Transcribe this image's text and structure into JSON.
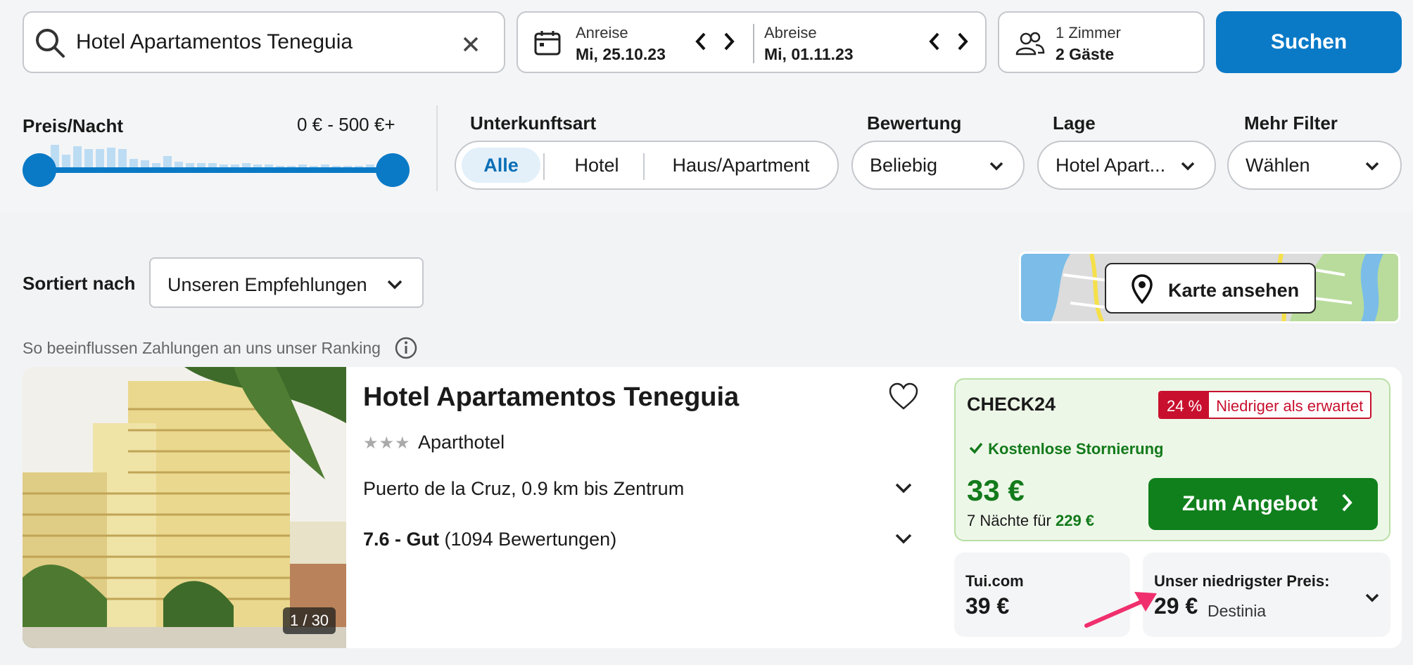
{
  "search": {
    "query": "Hotel Apartamentos Teneguia",
    "clear_icon": "close-icon",
    "submit_label": "Suchen"
  },
  "dates": {
    "checkin_label": "Anreise",
    "checkin_value": "Mi, 25.10.23",
    "checkout_label": "Abreise",
    "checkout_value": "Mi, 01.11.23"
  },
  "guests": {
    "rooms": "1 Zimmer",
    "guests": "2 Gäste"
  },
  "filters": {
    "price_label": "Preis/Nacht",
    "price_range": "0 € - 500 €+",
    "price_min_value": 0,
    "price_max_value": 500,
    "accommodation_label": "Unterkunftsart",
    "accommodation_options": [
      "Alle",
      "Hotel",
      "Haus/Apartment"
    ],
    "accommodation_selected": "Alle",
    "rating_label": "Bewertung",
    "rating_value": "Beliebig",
    "location_label": "Lage",
    "location_value": "Hotel Apart...",
    "more_label": "Mehr Filter",
    "more_value": "Wählen"
  },
  "sort": {
    "label": "Sortiert nach",
    "value": "Unseren Empfehlungen"
  },
  "map": {
    "button_label": "Karte ansehen"
  },
  "ranking_info": "So beeinflussen Zahlungen an uns unser Ranking",
  "hotel": {
    "name": "Hotel Apartamentos Teneguia",
    "stars": 3,
    "stars_glyph": "★★★",
    "type": "Aparthotel",
    "location": "Puerto de la Cruz, 0.9 km bis Zentrum",
    "rating_score": "7.6 - Gut",
    "rating_count": "(1094 Bewertungen)",
    "photo_counter": "1 / 30"
  },
  "offer": {
    "provider": "CHECK24",
    "discount_pct": "24 %",
    "discount_text": "Niedriger als erwartet",
    "free_cancel": "Kostenlose Stornierung",
    "price": "33 €",
    "nights_text": "7 Nächte für",
    "total": "229 €",
    "cta_label": "Zum Angebot"
  },
  "alternatives": [
    {
      "provider": "Tui.com",
      "price": "39 €"
    },
    {
      "label": "Unser niedrigster Preis:",
      "price": "29 €",
      "provider": "Destinia"
    }
  ],
  "colors": {
    "brand_blue": "#0a7ac7",
    "offer_green": "#137a1b",
    "badge_red": "#c8102e",
    "annotation_pink": "#f0306e"
  }
}
